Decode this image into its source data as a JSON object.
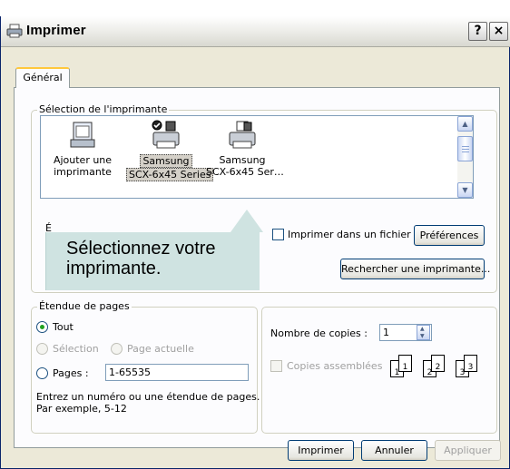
{
  "window": {
    "title": "Imprimer",
    "help_glyph": "?",
    "close_glyph": "×"
  },
  "tabs": [
    {
      "label": "Général"
    }
  ],
  "printer_group": {
    "label": "Sélection de l'imprimante",
    "printers": [
      {
        "line1": "Ajouter une",
        "line2": "imprimante"
      },
      {
        "line1": "Samsung",
        "line2": "SCX-6x45 Series"
      },
      {
        "line1": "Samsung",
        "line2": "SCX-6x45 Ser…"
      }
    ],
    "status_label_partial": "É",
    "print_to_file_label": "Imprimer dans un fichier",
    "preferences_button": "Préférences",
    "find_printer_button": "Rechercher une imprimante..."
  },
  "callout": {
    "text": "Sélectionnez votre imprimante."
  },
  "page_range": {
    "label": "Étendue de pages",
    "all_label": "Tout",
    "selection_label": "Sélection",
    "current_page_label": "Page actuelle",
    "pages_label": "Pages :",
    "pages_value": "1-65535",
    "help_text_line1": "Entrez un numéro ou une étendue de pages.",
    "help_text_line2": "Par exemple, 5-12"
  },
  "copies": {
    "count_label": "Nombre de copies :",
    "count_value": "1",
    "collate_label": "Copies assemblées",
    "collate_pages": [
      "1",
      "1",
      "2",
      "2",
      "3",
      "3"
    ]
  },
  "footer": {
    "print_button": "Imprimer",
    "cancel_button": "Annuler",
    "apply_button": "Appliquer"
  },
  "colors": {
    "accent_tab": "#ffc83c",
    "callout_bg": "#cfe3e1",
    "radio_dot": "#21a121"
  }
}
